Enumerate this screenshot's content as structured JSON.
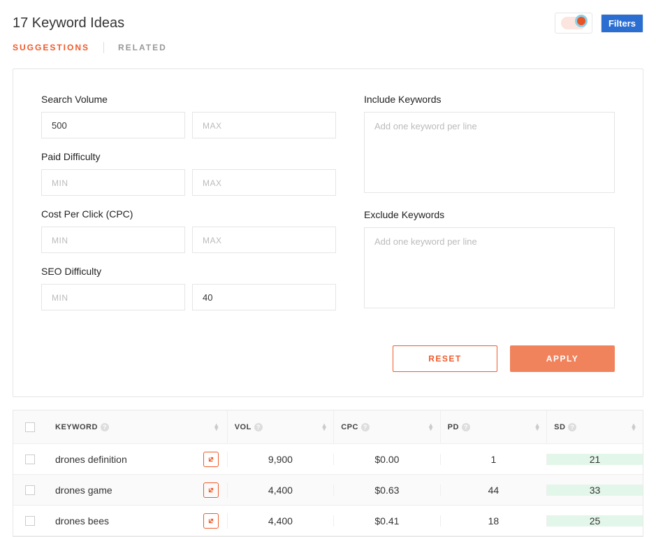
{
  "header": {
    "title": "17 Keyword Ideas",
    "filters_button": "Filters"
  },
  "tabs": {
    "suggestions": "Suggestions",
    "related": "Related"
  },
  "filters": {
    "search_volume": {
      "label": "Search Volume",
      "min_value": "500",
      "min_placeholder": "MIN",
      "max_value": "",
      "max_placeholder": "MAX"
    },
    "paid_difficulty": {
      "label": "Paid Difficulty",
      "min_value": "",
      "min_placeholder": "MIN",
      "max_value": "",
      "max_placeholder": "MAX"
    },
    "cpc": {
      "label": "Cost Per Click (CPC)",
      "min_value": "",
      "min_placeholder": "MIN",
      "max_value": "",
      "max_placeholder": "MAX"
    },
    "seo_difficulty": {
      "label": "SEO Difficulty",
      "min_value": "",
      "min_placeholder": "MIN",
      "max_value": "40",
      "max_placeholder": "MAX"
    },
    "include_keywords": {
      "label": "Include Keywords",
      "value": "",
      "placeholder": "Add one keyword per line"
    },
    "exclude_keywords": {
      "label": "Exclude Keywords",
      "value": "",
      "placeholder": "Add one keyword per line"
    },
    "reset_label": "Reset",
    "apply_label": "Apply"
  },
  "table": {
    "columns": {
      "keyword": "Keyword",
      "vol": "Vol",
      "cpc": "CPC",
      "pd": "PD",
      "sd": "SD"
    },
    "rows": [
      {
        "keyword": "drones definition",
        "vol": "9,900",
        "cpc": "$0.00",
        "pd": "1",
        "sd": "21",
        "sd_class": "sd-cell-green"
      },
      {
        "keyword": "drones game",
        "vol": "4,400",
        "cpc": "$0.63",
        "pd": "44",
        "sd": "33",
        "sd_class": "sd-cell-green"
      },
      {
        "keyword": "drones bees",
        "vol": "4,400",
        "cpc": "$0.41",
        "pd": "18",
        "sd": "25",
        "sd_class": "sd-cell-green"
      }
    ]
  }
}
